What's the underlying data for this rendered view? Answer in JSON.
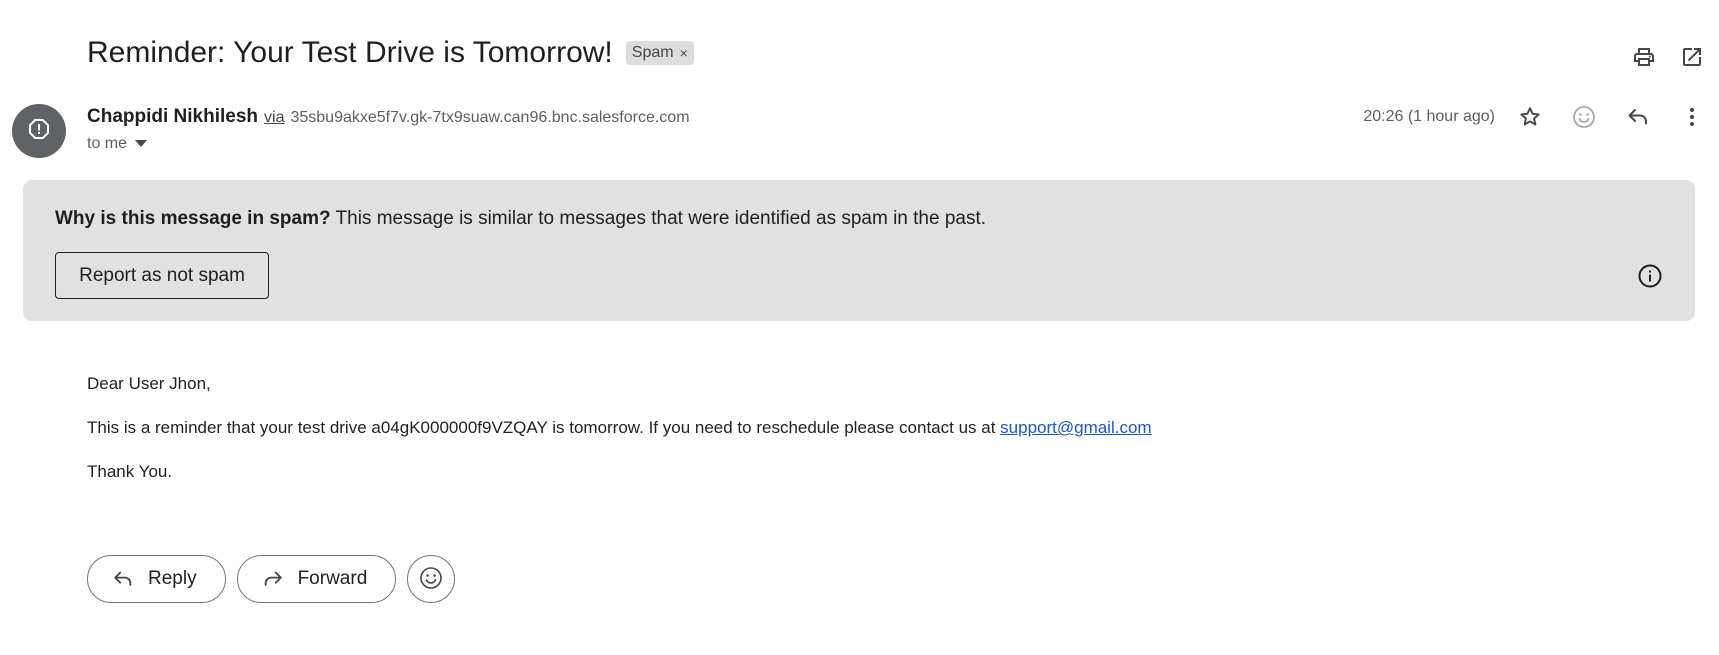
{
  "email": {
    "subject": "Reminder: Your Test Drive is Tomorrow!",
    "label": "Spam",
    "label_remove": "×",
    "sender_name": "Chappidi Nikhilesh",
    "via_text": "via",
    "via_domain": "35sbu9akxe5f7v.gk-7tx9suaw.can96.bnc.salesforce.com",
    "recipient": "to me",
    "timestamp": "20:26 (1 hour ago)"
  },
  "spam_banner": {
    "why_bold": "Why is this message in spam?",
    "why_text": " This message is similar to messages that were identified as spam in the past.",
    "report_button": "Report as not spam"
  },
  "body": {
    "greeting": "Dear User Jhon,",
    "line1_prefix": "This is a reminder that your test drive a04gK000000f9VZQAY is tomorrow. If you need to reschedule please contact us at ",
    "support_email": "support@gmail.com",
    "closing": "Thank You."
  },
  "actions": {
    "reply": "Reply",
    "forward": "Forward"
  },
  "icons": {
    "top": [
      "print-icon",
      "open-in-new-window-icon"
    ],
    "header": [
      "star-icon",
      "emoji-reaction-icon",
      "reply-icon",
      "more-vert-icon"
    ],
    "avatar": "spam-warning-icon",
    "banner": "info-icon"
  },
  "colors": {
    "banner_bg": "#e1e1e1",
    "avatar_bg": "#5f6368",
    "link": "#1a55d6",
    "chip_bg": "#dddddd"
  }
}
